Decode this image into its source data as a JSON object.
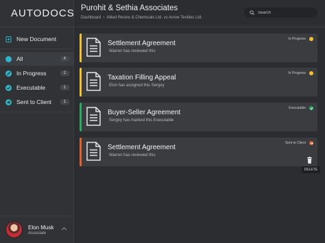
{
  "app": {
    "name": "AUTODOCS",
    "accent": "#2fb4c9"
  },
  "sidebar": {
    "items": [
      {
        "label": "New Document",
        "count": null,
        "icon": "plus-doc-icon",
        "color": "#2fb4c9"
      },
      {
        "label": "All",
        "count": "4",
        "icon": "circle-icon",
        "color": "#2fb4c9"
      },
      {
        "label": "In Progress",
        "count": "2",
        "icon": "pencil-icon",
        "color": "#2fb4c9"
      },
      {
        "label": "Executable",
        "count": "1",
        "icon": "check-icon",
        "color": "#2fb4c9"
      },
      {
        "label": "Sent to Client",
        "count": "1",
        "icon": "arrow-icon",
        "color": "#2fb4c9"
      }
    ]
  },
  "header": {
    "title": "Purohit & Sethia Associates",
    "breadcrumb": [
      "Dashboard",
      "Allied Resins & Chemicals Ltd. vs Arrow Textiles Ltd."
    ],
    "search_placeholder": "Search"
  },
  "documents": [
    {
      "title": "Settlement Agreement",
      "subtitle": "Warren has reviewed this",
      "status": "In Progress",
      "color": "#f2c230",
      "status_icon": "yellow-dot-icon"
    },
    {
      "title": "Taxation Filling Appeal",
      "subtitle": "Elon has assigned this Sergey",
      "status": "In Progress",
      "color": "#f2c230",
      "status_icon": "yellow-dot-icon"
    },
    {
      "title": "Buyer-Seller Agreement",
      "subtitle": "Sergey has marked this Executable",
      "status": "Executable",
      "color": "#27ae60",
      "status_icon": "green-check-icon"
    },
    {
      "title": "Settlement Agreement",
      "subtitle": "Warren has reviewed this",
      "status": "Sent to Client",
      "color": "#e2622b",
      "status_icon": "orange-arrow-icon"
    }
  ],
  "delete_tooltip": "DELETE",
  "user": {
    "name": "Elon Musk",
    "role": "Associate"
  }
}
